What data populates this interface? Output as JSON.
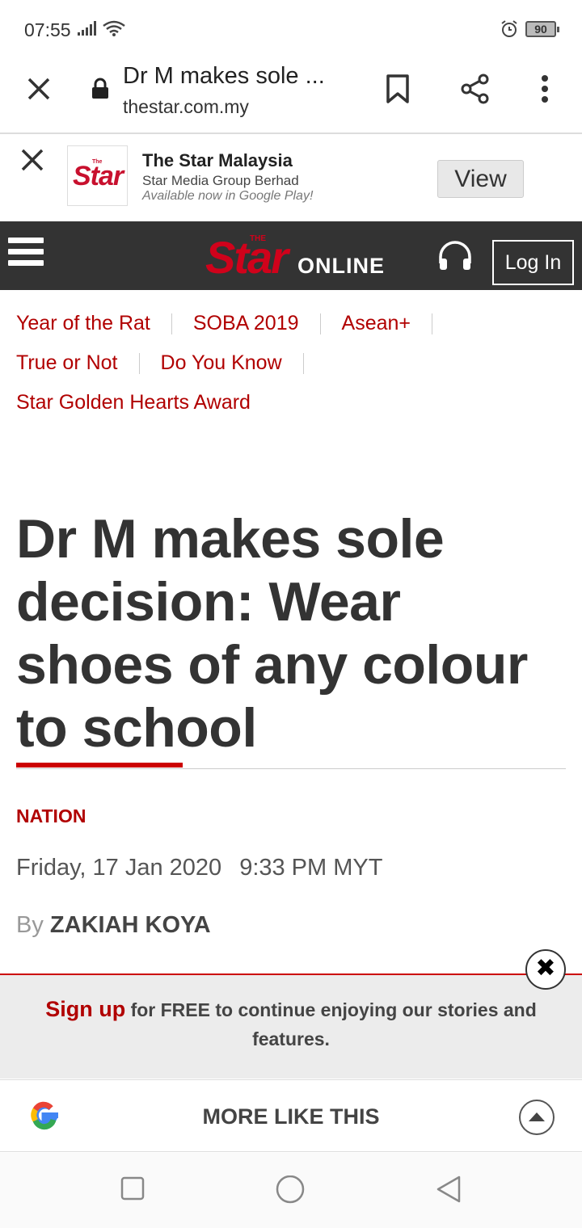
{
  "status_bar": {
    "time": "07:55",
    "battery": "90",
    "icons": [
      "signal-icon",
      "wifi-icon",
      "alarm-icon",
      "battery-icon"
    ]
  },
  "browser": {
    "page_title": "Dr M makes sole ...",
    "url": "thestar.com.my",
    "icons": [
      "close-icon",
      "lock-icon",
      "bookmark-icon",
      "share-icon",
      "more-vert-icon"
    ]
  },
  "app_banner": {
    "logo_text": "Star",
    "logo_small": "The",
    "app_name": "The Star Malaysia",
    "publisher": "Star Media Group Berhad",
    "availability": "Available now in Google Play!",
    "view_label": "View"
  },
  "site_header": {
    "brand_the": "THE",
    "brand_star": "Star",
    "brand_online": "ONLINE",
    "login_label": "Log In",
    "accent_color": "#d0021b"
  },
  "topics": {
    "row1": [
      "Year of the Rat",
      "SOBA 2019",
      "Asean+"
    ],
    "row2": [
      "True or Not",
      "Do You Know"
    ],
    "row3": [
      "Star Golden Hearts Award"
    ]
  },
  "article": {
    "headline": "Dr M makes sole decision: Wear shoes of any colour to school",
    "category": "NATION",
    "date": "Friday, 17 Jan 2020",
    "time": "9:33 PM MYT",
    "by_prefix": "By",
    "author": "ZAKIAH KOYA"
  },
  "signup": {
    "link": "Sign up",
    "message": " for FREE to continue enjoying our stories and features.",
    "close_symbol": "✖"
  },
  "more": {
    "label": "MORE LIKE THIS"
  }
}
